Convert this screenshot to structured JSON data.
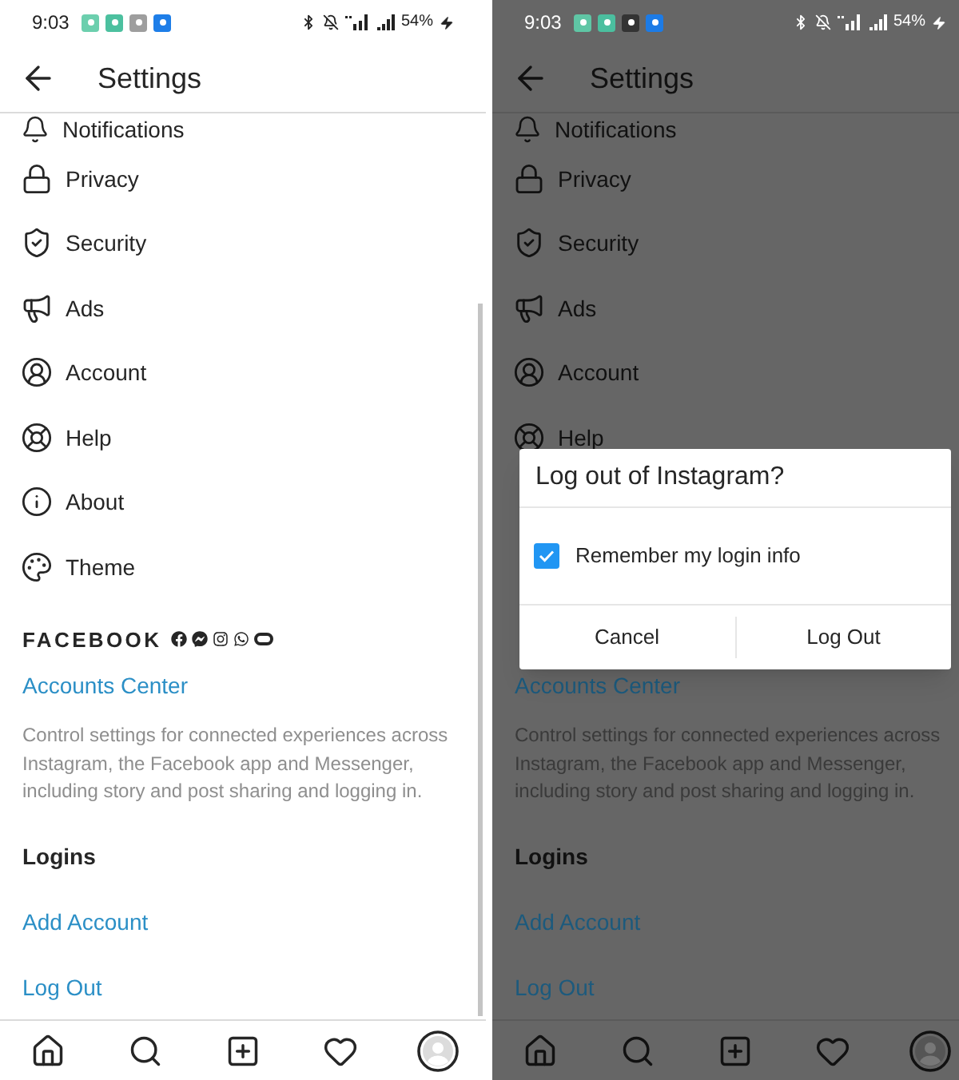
{
  "screens": [
    {
      "status_bar": {
        "time": "9:03",
        "app_icons": [
          {
            "color": "#6ccfae"
          },
          {
            "color": "#4cc09f"
          },
          {
            "color": "#9e9e9e"
          },
          {
            "color": "#1e7ee8"
          }
        ],
        "battery": "54%"
      },
      "header": {
        "title": "Settings"
      },
      "menu": [
        {
          "label": "Notifications"
        },
        {
          "label": "Privacy"
        },
        {
          "label": "Security"
        },
        {
          "label": "Ads"
        },
        {
          "label": "Account"
        },
        {
          "label": "Help"
        },
        {
          "label": "About"
        },
        {
          "label": "Theme"
        }
      ],
      "accounts_section": {
        "wordmark": "FACEBOOK",
        "link": "Accounts Center",
        "description": "Control settings for connected experiences across Instagram, the Facebook app and Messenger, including story and post sharing and logging in."
      },
      "logins": {
        "heading": "Logins",
        "links": [
          "Add Account",
          "Log Out"
        ]
      }
    },
    {
      "status_bar": {
        "time": "9:03",
        "app_icons": [
          {
            "color": "#5fc6a5"
          },
          {
            "color": "#4bbf9f"
          },
          {
            "color": "#333333"
          },
          {
            "color": "#1c7be6"
          }
        ],
        "battery": "54%"
      },
      "header": {
        "title": "Settings"
      },
      "menu": [
        {
          "label": "Notifications"
        },
        {
          "label": "Privacy"
        },
        {
          "label": "Security"
        },
        {
          "label": "Ads"
        },
        {
          "label": "Account"
        },
        {
          "label": "Help"
        }
      ],
      "dialog": {
        "title": "Log out of Instagram?",
        "checkbox": {
          "label": "Remember my login info",
          "checked": true
        },
        "buttons": [
          "Cancel",
          "Log Out"
        ]
      },
      "accounts_section": {
        "link": "Accounts Center",
        "description": "Control settings for connected experiences across Instagram, the Facebook app and Messenger, including story and post sharing and logging in."
      },
      "logins": {
        "heading": "Logins",
        "links": [
          "Add Account",
          "Log Out"
        ]
      }
    }
  ]
}
